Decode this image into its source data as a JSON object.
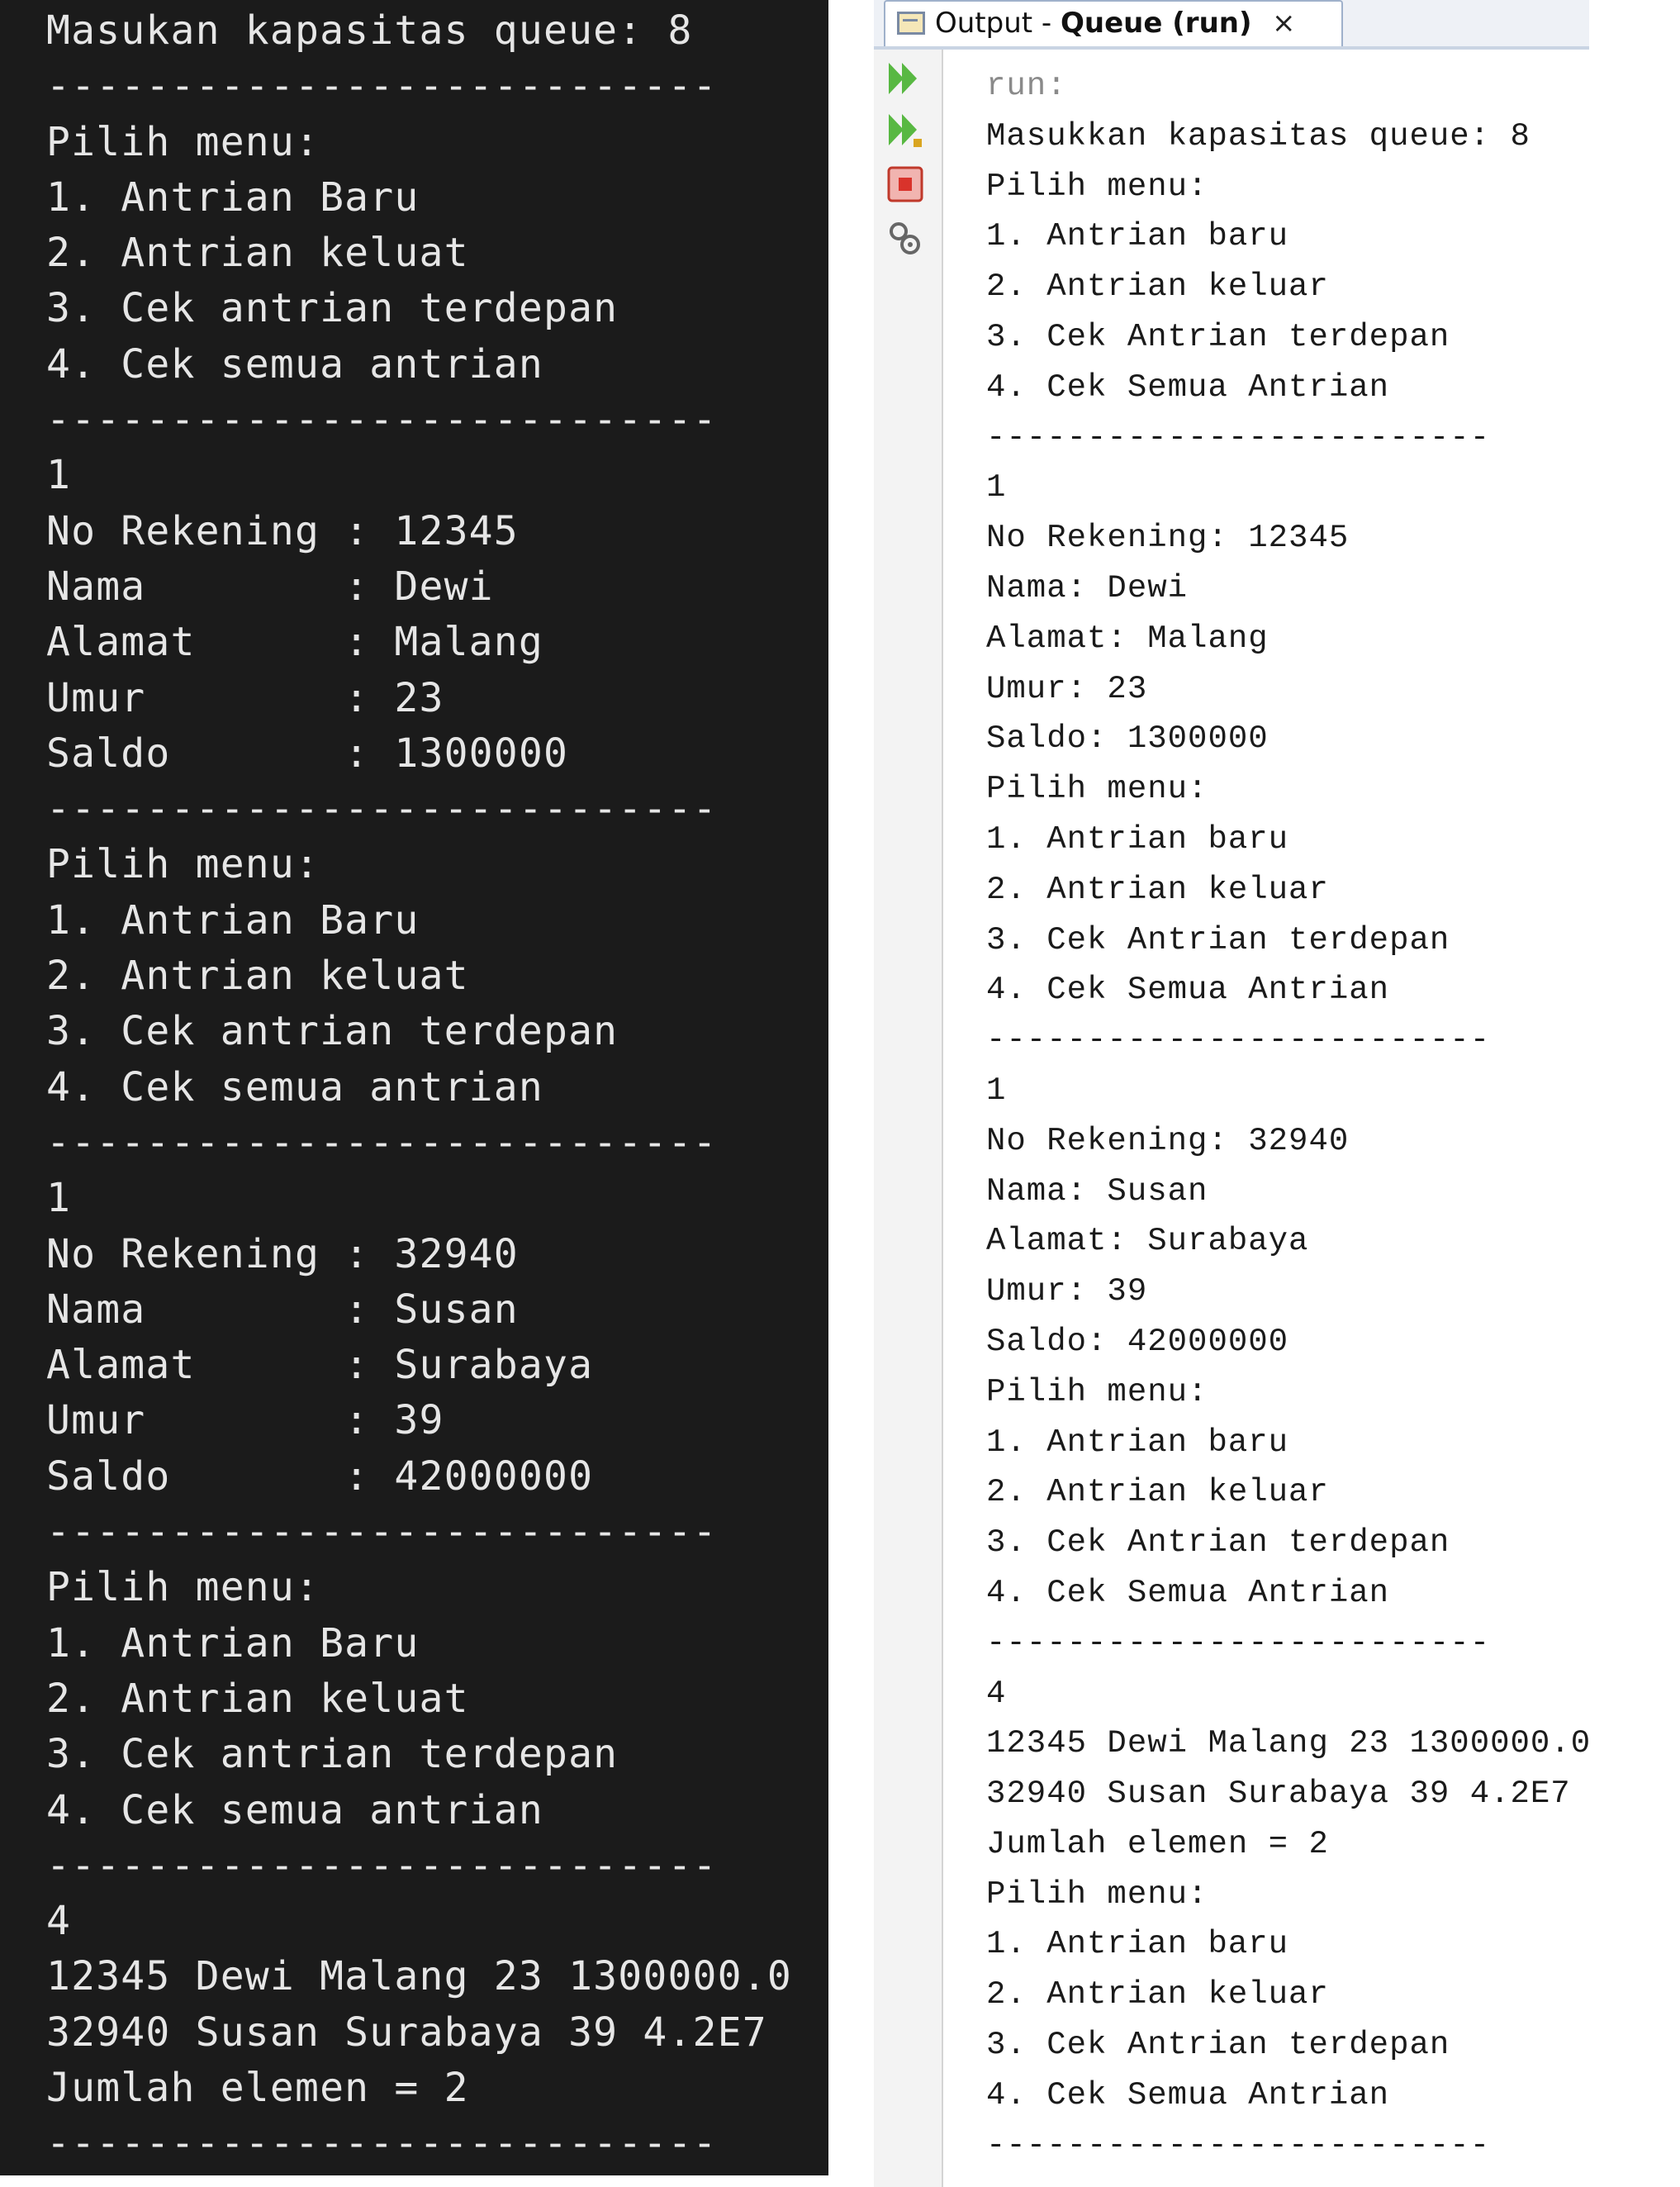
{
  "terminal": {
    "lines": [
      "Masukan kapasitas queue: 8",
      "---------------------------",
      "Pilih menu:",
      "1. Antrian Baru",
      "2. Antrian keluat",
      "3. Cek antrian terdepan",
      "4. Cek semua antrian",
      "---------------------------",
      "1",
      "No Rekening : 12345",
      "Nama        : Dewi",
      "Alamat      : Malang",
      "Umur        : 23",
      "Saldo       : 1300000",
      "---------------------------",
      "Pilih menu:",
      "1. Antrian Baru",
      "2. Antrian keluat",
      "3. Cek antrian terdepan",
      "4. Cek semua antrian",
      "---------------------------",
      "1",
      "No Rekening : 32940",
      "Nama        : Susan",
      "Alamat      : Surabaya",
      "Umur        : 39",
      "Saldo       : 42000000",
      "---------------------------",
      "Pilih menu:",
      "1. Antrian Baru",
      "2. Antrian keluat",
      "3. Cek antrian terdepan",
      "4. Cek semua antrian",
      "---------------------------",
      "4",
      "12345 Dewi Malang 23 1300000.0",
      "32940 Susan Surabaya 39 4.2E7",
      "Jumlah elemen = 2",
      "---------------------------"
    ]
  },
  "output_window": {
    "tab": {
      "prefix": "Output - ",
      "title": "Queue (run)",
      "close": "×"
    },
    "gutter_buttons": [
      "rerun-icon",
      "rerun-with-options-icon",
      "stop-icon",
      "settings-icon"
    ],
    "lines": [
      "run:",
      "Masukkan kapasitas queue: 8",
      "Pilih menu:",
      "1. Antrian baru",
      "2. Antrian keluar",
      "3. Cek Antrian terdepan",
      "4. Cek Semua Antrian",
      "-------------------------",
      "1",
      "No Rekening: 12345",
      "Nama: Dewi",
      "Alamat: Malang",
      "Umur: 23",
      "Saldo: 1300000",
      "Pilih menu:",
      "1. Antrian baru",
      "2. Antrian keluar",
      "3. Cek Antrian terdepan",
      "4. Cek Semua Antrian",
      "-------------------------",
      "1",
      "No Rekening: 32940",
      "Nama: Susan",
      "Alamat: Surabaya",
      "Umur: 39",
      "Saldo: 42000000",
      "Pilih menu:",
      "1. Antrian baru",
      "2. Antrian keluar",
      "3. Cek Antrian terdepan",
      "4. Cek Semua Antrian",
      "-------------------------",
      "4",
      "12345 Dewi Malang 23 1300000.0",
      "32940 Susan Surabaya 39 4.2E7",
      "Jumlah elemen = 2",
      "Pilih menu:",
      "1. Antrian baru",
      "2. Antrian keluar",
      "3. Cek Antrian terdepan",
      "4. Cek Semua Antrian",
      "-------------------------"
    ]
  },
  "colors": {
    "terminal_bg": "#1b1b1b",
    "terminal_text": "#e6e6e6",
    "output_text": "#1a1a1a",
    "run_arrow": "#58b842",
    "stop": "#d9332b"
  }
}
